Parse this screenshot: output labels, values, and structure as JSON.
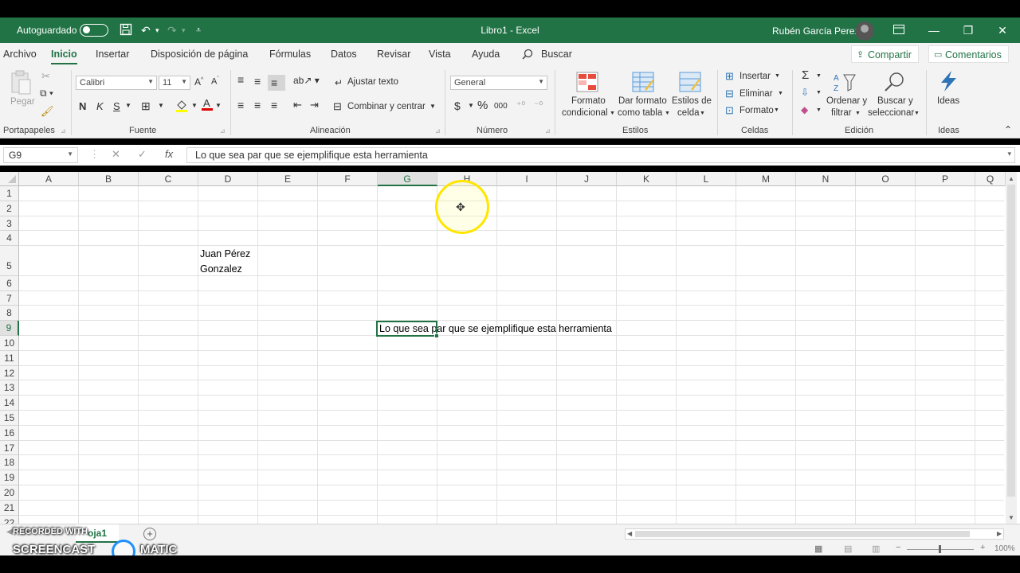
{
  "titlebar": {
    "autosave_label": "Autoguardado",
    "doc_title": "Libro1  -  Excel",
    "user_name": "Rubén García Perez"
  },
  "menu_tabs": [
    {
      "label": "Archivo"
    },
    {
      "label": "Inicio"
    },
    {
      "label": "Insertar"
    },
    {
      "label": "Disposición de página"
    },
    {
      "label": "Fórmulas"
    },
    {
      "label": "Datos"
    },
    {
      "label": "Revisar"
    },
    {
      "label": "Vista"
    },
    {
      "label": "Ayuda"
    }
  ],
  "search_label": "Buscar",
  "share_label": "Compartir",
  "comments_label": "Comentarios",
  "ribbon": {
    "clipboard": {
      "paste": "Pegar",
      "group": "Portapapeles"
    },
    "font": {
      "name": "Calibri",
      "size": "11",
      "bold": "N",
      "italic": "K",
      "underline": "S",
      "group": "Fuente"
    },
    "alignment": {
      "wrap": "Ajustar texto",
      "merge": "Combinar y centrar",
      "group": "Alineación"
    },
    "number": {
      "format": "General",
      "currency": "$",
      "percent": "%",
      "thousands": "000",
      "group": "Número"
    },
    "styles": {
      "conditional": [
        "Formato",
        "condicional"
      ],
      "table": [
        "Dar formato",
        "como tabla"
      ],
      "cell": [
        "Estilos de",
        "celda"
      ],
      "group": "Estilos"
    },
    "cells": {
      "insert": "Insertar",
      "delete": "Eliminar",
      "format": "Formato",
      "group": "Celdas"
    },
    "editing": {
      "sort": [
        "Ordenar y",
        "filtrar"
      ],
      "find": [
        "Buscar y",
        "seleccionar"
      ],
      "group": "Edición"
    },
    "ideas": {
      "label": "Ideas",
      "group": "Ideas"
    }
  },
  "formula_bar": {
    "name_box": "G9",
    "content": "Lo que sea par que se ejemplifique esta herramienta"
  },
  "grid": {
    "columns": [
      "A",
      "B",
      "C",
      "D",
      "E",
      "F",
      "G",
      "H",
      "I",
      "J",
      "K",
      "L",
      "M",
      "N",
      "O",
      "P",
      "Q"
    ],
    "rows": [
      "1",
      "2",
      "3",
      "4",
      "5",
      "6",
      "7",
      "8",
      "9",
      "10",
      "11",
      "12",
      "13",
      "14",
      "15",
      "16",
      "17",
      "18",
      "19",
      "20",
      "21",
      "22"
    ],
    "selected_column": "G",
    "selected_row": "9",
    "cell_d5_line1": "Juan Pérez",
    "cell_d5_line2": "Gonzalez",
    "cell_g9": "Lo que sea par que se ejemplifique esta herramienta"
  },
  "sheets": [
    {
      "name": "Hoja1",
      "visible_text": "oja1"
    }
  ],
  "status": {
    "zoom": "100%"
  },
  "watermark": {
    "line1": "RECORDED WITH",
    "line2": "SCREENCAST",
    "line2b": "MATIC"
  }
}
